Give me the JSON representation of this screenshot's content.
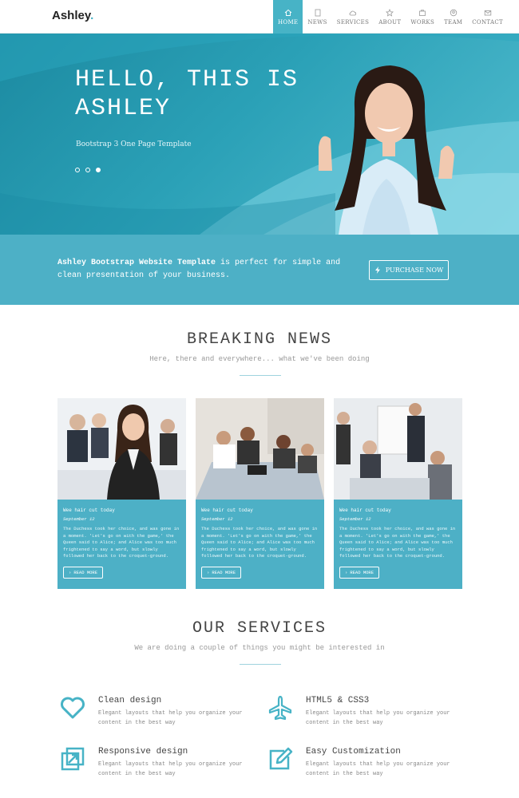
{
  "brand": {
    "name": "Ashley",
    "accent": "#47b3c6"
  },
  "nav": [
    {
      "label": "HOME",
      "icon": "home-icon",
      "active": true
    },
    {
      "label": "NEWS",
      "icon": "document-icon"
    },
    {
      "label": "SERVICES",
      "icon": "cloud-icon"
    },
    {
      "label": "ABOUT",
      "icon": "star-icon"
    },
    {
      "label": "WORKS",
      "icon": "briefcase-icon"
    },
    {
      "label": "TEAM",
      "icon": "users-icon"
    },
    {
      "label": "CONTACT",
      "icon": "mail-icon"
    }
  ],
  "hero": {
    "title": "HELLO, THIS IS ASHLEY",
    "subtitle": "Bootstrap 3 One Page Template",
    "slides": 3,
    "active_slide": 3
  },
  "banner": {
    "strong": "Ashley Bootstrap Website Template",
    "text": " is perfect for simple and clean presentation of your business.",
    "button": "PURCHASE NOW"
  },
  "news": {
    "title": "BREAKING NEWS",
    "subtitle": "Here, there and everywhere... what we've been doing",
    "cards": [
      {
        "title": "Wee hair cut today",
        "date": "September 12",
        "text": "The Duchess took her choice, and was gone in a moment. 'Let's go on with the game,' the Queen said to Alice; and Alice was too much frightened to say a word, but slowly followed her back to the croquet-ground.",
        "button": "READ MORE"
      },
      {
        "title": "Wee hair cut today",
        "date": "September 12",
        "text": "The Duchess took her choice, and was gone in a moment. 'Let's go on with the game,' the Queen said to Alice; and Alice was too much frightened to say a word, but slowly followed her back to the croquet-ground.",
        "button": "READ MORE"
      },
      {
        "title": "Wee hair cut today",
        "date": "September 12",
        "text": "The Duchess took her choice, and was gone in a moment. 'Let's go on with the game,' the Queen said to Alice; and Alice was too much frightened to say a word, but slowly followed her back to the croquet-ground.",
        "button": "READ MORE"
      }
    ]
  },
  "services": {
    "title": "OUR SERVICES",
    "subtitle": "We are doing a couple of things you might be interested in",
    "items": [
      {
        "title": "Clean design",
        "text": "Elegant layouts that help you organize your content in the best way",
        "icon": "heart-icon"
      },
      {
        "title": "HTML5 & CSS3",
        "text": "Elegant layouts that help you organize your content in the best way",
        "icon": "plane-icon"
      },
      {
        "title": "Responsive design",
        "text": "Elegant layouts that help you organize your content in the best way",
        "icon": "resize-icon"
      },
      {
        "title": "Easy Customization",
        "text": "Elegant layouts that help you organize your content in the best way",
        "icon": "edit-icon"
      }
    ]
  }
}
